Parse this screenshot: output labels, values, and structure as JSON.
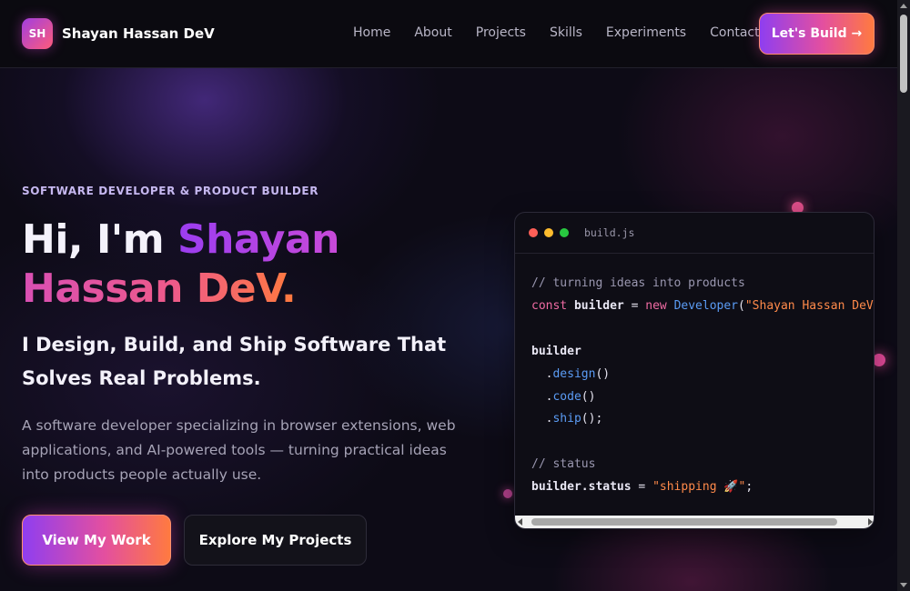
{
  "brand": {
    "logo_initials": "SH",
    "name": "Shayan Hassan DeV"
  },
  "nav": {
    "links": [
      {
        "label": "Home"
      },
      {
        "label": "About"
      },
      {
        "label": "Projects"
      },
      {
        "label": "Skills"
      },
      {
        "label": "Experiments"
      },
      {
        "label": "Contact"
      }
    ],
    "cta_label": "Let's Build →"
  },
  "hero": {
    "eyebrow": "SOFTWARE DEVELOPER & PRODUCT BUILDER",
    "headline_prefix": "Hi, I'm ",
    "headline_name_first": "Shayan",
    "headline_name_last": "Hassan DeV.",
    "subheadline": "I Design, Build, and Ship Software That Solves Real Problems.",
    "description": "A software developer specializing in browser extensions, web applications, and AI-powered tools — turning practical ideas into products people actually use.",
    "primary_button": "View My Work",
    "secondary_button": "Explore My Projects"
  },
  "code_window": {
    "filename": "build.js",
    "lines": {
      "comment1": "// turning ideas into products",
      "const_kw": "const",
      "builder_var": "builder",
      "assign": " = ",
      "new_kw": "new",
      "class_name": "Developer",
      "open_paren": "(",
      "arg": "\"Shayan Hassan DeV\"",
      "close_paren": ")",
      "builder2": "builder",
      "dot1": ".",
      "design": "design",
      "parens1": "()",
      "dot2": ".",
      "code": "code",
      "parens2": "()",
      "dot3": ".",
      "ship": "ship",
      "parens3": "();",
      "comment2": "// status",
      "status_obj": "builder",
      "status_prop": ".status",
      "status_assign": " = ",
      "status_value": "\"shipping 🚀\"",
      "status_end": ";"
    }
  },
  "colors": {
    "accent_purple": "#8f3ef0",
    "accent_pink": "#e34fa0",
    "accent_orange": "#ff7a40",
    "dot_red": "#ff5f57",
    "dot_yellow": "#febc2e",
    "dot_green": "#28c840"
  }
}
